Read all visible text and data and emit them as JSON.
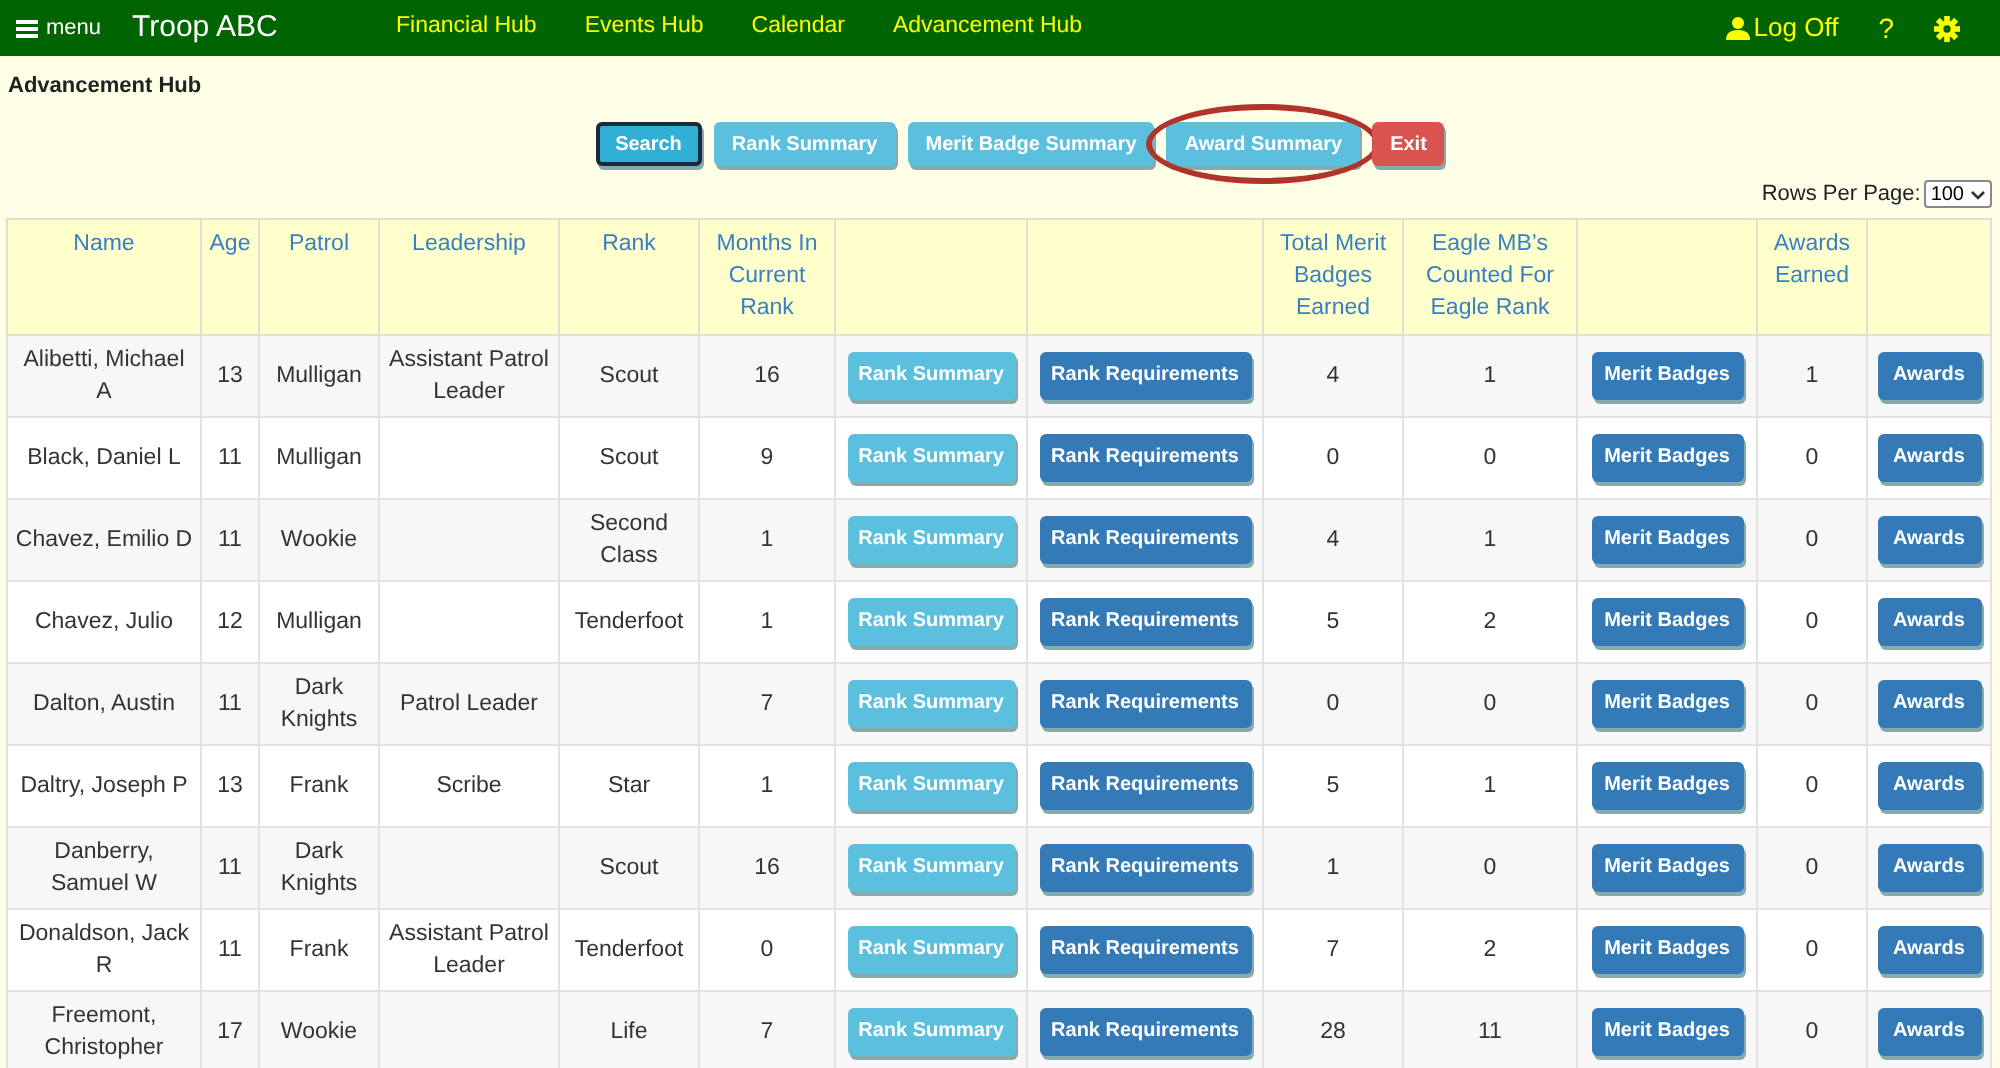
{
  "top_bar": {
    "menu_label": "menu",
    "brand": "Troop ABC",
    "nav": [
      "Financial Hub",
      "Events Hub",
      "Calendar",
      "Advancement Hub"
    ],
    "log_off": "Log Off",
    "help": "?"
  },
  "page_title": "Advancement Hub",
  "toolbar": [
    {
      "label": "Search",
      "kind": "primary",
      "selected": true,
      "highlighted": false
    },
    {
      "label": "Rank Summary",
      "kind": "info",
      "selected": false,
      "highlighted": false
    },
    {
      "label": "Merit Badge Summary",
      "kind": "info",
      "selected": false,
      "highlighted": false
    },
    {
      "label": "Award Summary",
      "kind": "info",
      "selected": false,
      "highlighted": true
    },
    {
      "label": "Exit",
      "kind": "danger",
      "selected": false,
      "highlighted": false
    }
  ],
  "rows_per_page": {
    "label": "Rows Per Page:",
    "value": "100"
  },
  "table": {
    "columns": [
      "Name",
      "Age",
      "Patrol",
      "Leadership",
      "Rank",
      "Months In Current Rank",
      "",
      "",
      "Total Merit Badges Earned",
      "Eagle MB’s Counted For Eagle Rank",
      "",
      "Awards Earned",
      ""
    ],
    "rows": [
      {
        "name": "Alibetti, Michael A",
        "age": "13",
        "patrol": "Mulligan",
        "leadership": "Assistant Patrol Leader",
        "rank": "Scout",
        "months": "16",
        "rank_summary": "Rank Summary",
        "rank_requirements": "Rank Requirements",
        "total_mb": "4",
        "eagle_mb": "1",
        "merit_badges": "Merit Badges",
        "awards": "1",
        "awards_button": "Awards"
      },
      {
        "name": "Black, Daniel L",
        "age": "11",
        "patrol": "Mulligan",
        "leadership": "",
        "rank": "Scout",
        "months": "9",
        "rank_summary": "Rank Summary",
        "rank_requirements": "Rank Requirements",
        "total_mb": "0",
        "eagle_mb": "0",
        "merit_badges": "Merit Badges",
        "awards": "0",
        "awards_button": "Awards"
      },
      {
        "name": "Chavez, Emilio D",
        "age": "11",
        "patrol": "Wookie",
        "leadership": "",
        "rank": "Second Class",
        "months": "1",
        "rank_summary": "Rank Summary",
        "rank_requirements": "Rank Requirements",
        "total_mb": "4",
        "eagle_mb": "1",
        "merit_badges": "Merit Badges",
        "awards": "0",
        "awards_button": "Awards"
      },
      {
        "name": "Chavez, Julio",
        "age": "12",
        "patrol": "Mulligan",
        "leadership": "",
        "rank": "Tenderfoot",
        "months": "1",
        "rank_summary": "Rank Summary",
        "rank_requirements": "Rank Requirements",
        "total_mb": "5",
        "eagle_mb": "2",
        "merit_badges": "Merit Badges",
        "awards": "0",
        "awards_button": "Awards"
      },
      {
        "name": "Dalton, Austin",
        "age": "11",
        "patrol": "Dark Knights",
        "leadership": "Patrol Leader",
        "rank": "",
        "months": "7",
        "rank_summary": "Rank Summary",
        "rank_requirements": "Rank Requirements",
        "total_mb": "0",
        "eagle_mb": "0",
        "merit_badges": "Merit Badges",
        "awards": "0",
        "awards_button": "Awards"
      },
      {
        "name": "Daltry, Joseph P",
        "age": "13",
        "patrol": "Frank",
        "leadership": "Scribe",
        "rank": "Star",
        "months": "1",
        "rank_summary": "Rank Summary",
        "rank_requirements": "Rank Requirements",
        "total_mb": "5",
        "eagle_mb": "1",
        "merit_badges": "Merit Badges",
        "awards": "0",
        "awards_button": "Awards"
      },
      {
        "name": "Danberry, Samuel W",
        "age": "11",
        "patrol": "Dark Knights",
        "leadership": "",
        "rank": "Scout",
        "months": "16",
        "rank_summary": "Rank Summary",
        "rank_requirements": "Rank Requirements",
        "total_mb": "1",
        "eagle_mb": "0",
        "merit_badges": "Merit Badges",
        "awards": "0",
        "awards_button": "Awards"
      },
      {
        "name": "Donaldson, Jack R",
        "age": "11",
        "patrol": "Frank",
        "leadership": "Assistant Patrol Leader",
        "rank": "Tenderfoot",
        "months": "0",
        "rank_summary": "Rank Summary",
        "rank_requirements": "Rank Requirements",
        "total_mb": "7",
        "eagle_mb": "2",
        "merit_badges": "Merit Badges",
        "awards": "0",
        "awards_button": "Awards"
      },
      {
        "name": "Freemont, Christopher",
        "age": "17",
        "patrol": "Wookie",
        "leadership": "",
        "rank": "Life",
        "months": "7",
        "rank_summary": "Rank Summary",
        "rank_requirements": "Rank Requirements",
        "total_mb": "28",
        "eagle_mb": "11",
        "merit_badges": "Merit Badges",
        "awards": "0",
        "awards_button": "Awards"
      }
    ]
  }
}
